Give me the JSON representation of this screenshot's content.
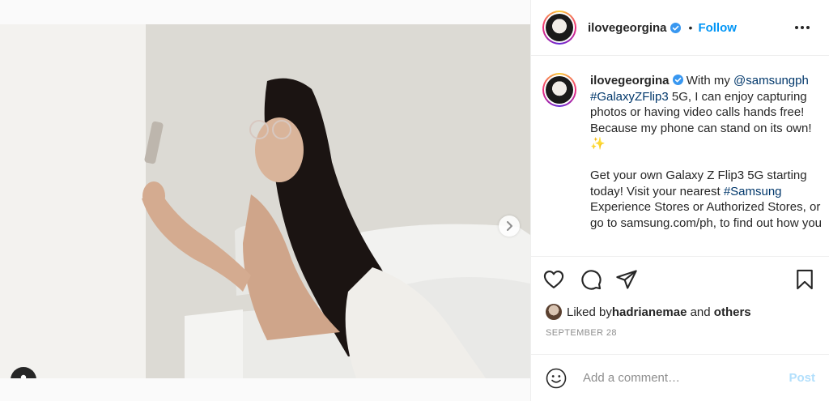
{
  "post": {
    "username": "ilovegeorgina",
    "follow_label": "Follow",
    "bullet": "•",
    "caption": {
      "username": "ilovegeorgina",
      "intro": " With my ",
      "mention": "@samsungph",
      "space1": " ",
      "hashtag1": "#GalaxyZFlip3",
      "body1": " 5G, I can enjoy capturing photos or having video calls hands free! Because my phone can stand on its own! ✨",
      "body2_a": "Get your own Galaxy Z Flip3 5G starting today! Visit your nearest ",
      "hashtag2": "#Samsung",
      "body2_b": " Experience Stores or Authorized Stores, or go to samsung.com/ph, to find out how you"
    },
    "likes": {
      "prefix": "Liked by ",
      "user": "hadrianemae",
      "and": " and ",
      "others": "others"
    },
    "date": "SEPTEMBER 28",
    "comment": {
      "placeholder": "Add a comment…",
      "post_label": "Post"
    },
    "carousel": {
      "slide_count": 4,
      "active_index": 0
    },
    "colors": {
      "link": "#00376b",
      "follow": "#0095f6",
      "post_disabled": "#b2dffc",
      "verified": "#3897f0"
    },
    "icons": [
      "verified-icon",
      "more-options-icon",
      "heart-icon",
      "comment-icon",
      "share-icon",
      "bookmark-icon",
      "emoji-icon",
      "user-tag-icon",
      "next-arrow-icon"
    ]
  }
}
